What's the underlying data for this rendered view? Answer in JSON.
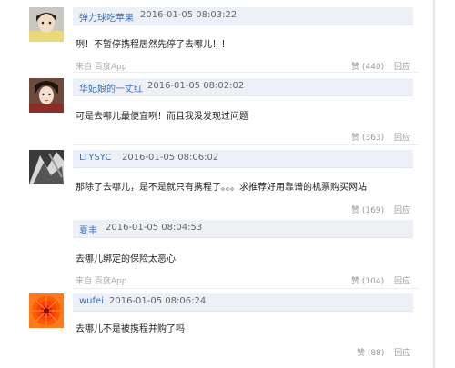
{
  "comments": [
    {
      "username": "弹力球吃苹果",
      "timestamp": "2016-01-05 08:03:22",
      "text": "咧！不暂停携程居然先停了去哪儿！！",
      "source": "来自 百度App",
      "like_label": "赞",
      "like_count": "(440)",
      "reply_label": "回应"
    },
    {
      "username": "华妃娘的一丈红",
      "timestamp": "2016-01-05 08:02:02",
      "text": "可是去哪儿最便宜咧！而且我没发现过问题",
      "like_label": "赞",
      "like_count": "(363)",
      "reply_label": "回应"
    },
    {
      "username": "LTYSYC",
      "timestamp": "2016-01-05 08:06:02",
      "text": "那除了去哪儿，是不是就只有携程了。。。求推荐好用靠谱的机票购买网站",
      "like_label": "赞",
      "like_count": "(169)",
      "reply_label": "回应"
    },
    {
      "username": "夏丰",
      "timestamp": "2016-01-05 08:04:53",
      "text": "去哪儿绑定的保险太恶心",
      "source": "来自 百度App",
      "like_label": "赞",
      "like_count": "(104)",
      "reply_label": "回应"
    },
    {
      "username": "wufei",
      "timestamp": "2016-01-05 08:06:24",
      "text": "去哪儿不是被携程并购了吗",
      "like_label": "赞",
      "like_count": "(88)",
      "reply_label": "回应"
    }
  ]
}
